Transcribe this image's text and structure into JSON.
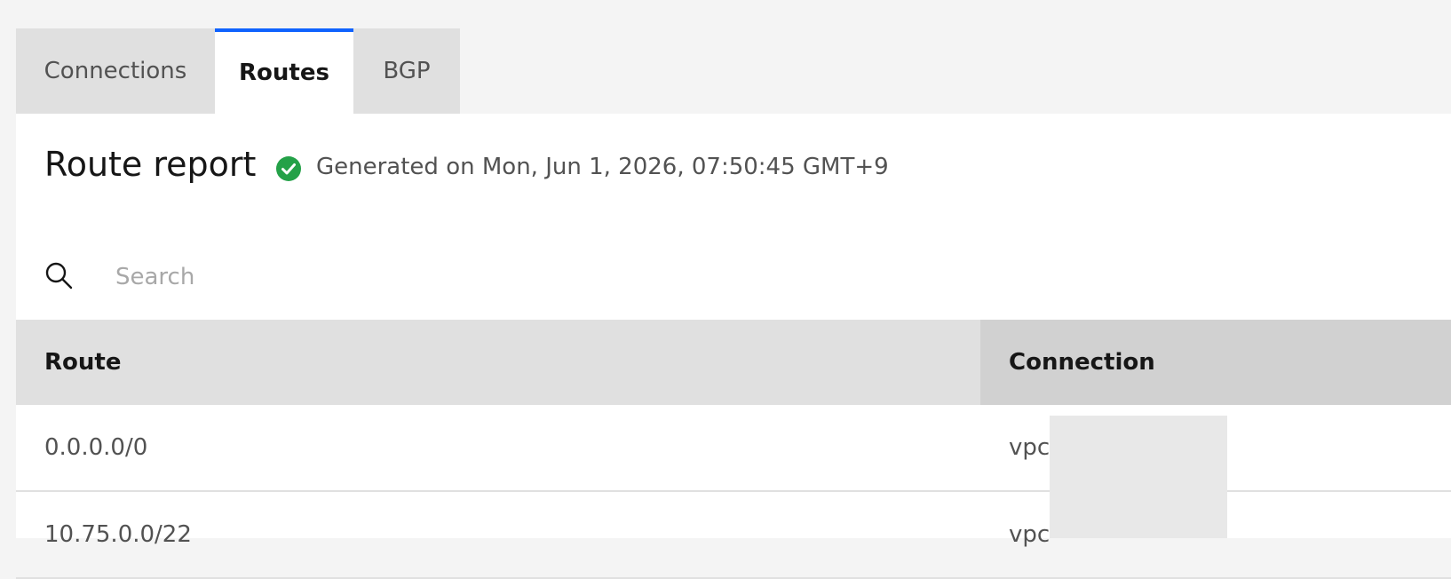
{
  "tabs": [
    {
      "label": "Connections",
      "active": false
    },
    {
      "label": "Routes",
      "active": true
    },
    {
      "label": "BGP",
      "active": false
    }
  ],
  "report": {
    "title": "Route report",
    "status_icon": "checkmark-filled-icon",
    "status_text": "Generated on Mon, Jun 1, 2026, 07:50:45 GMT+9"
  },
  "search": {
    "icon": "search-icon",
    "placeholder": "Search",
    "value": ""
  },
  "table": {
    "headers": [
      "Route",
      "Connection"
    ],
    "rows": [
      {
        "route": "0.0.0.0/0",
        "connection": "vpc-"
      },
      {
        "route": "10.75.0.0/22",
        "connection": "vpc-"
      }
    ]
  },
  "colors": {
    "accent": "#0f62fe",
    "success": "#24a148",
    "background": "#f4f4f4",
    "header_bg": "#e0e0e0",
    "sorted_header_bg": "#d1d1d1"
  }
}
